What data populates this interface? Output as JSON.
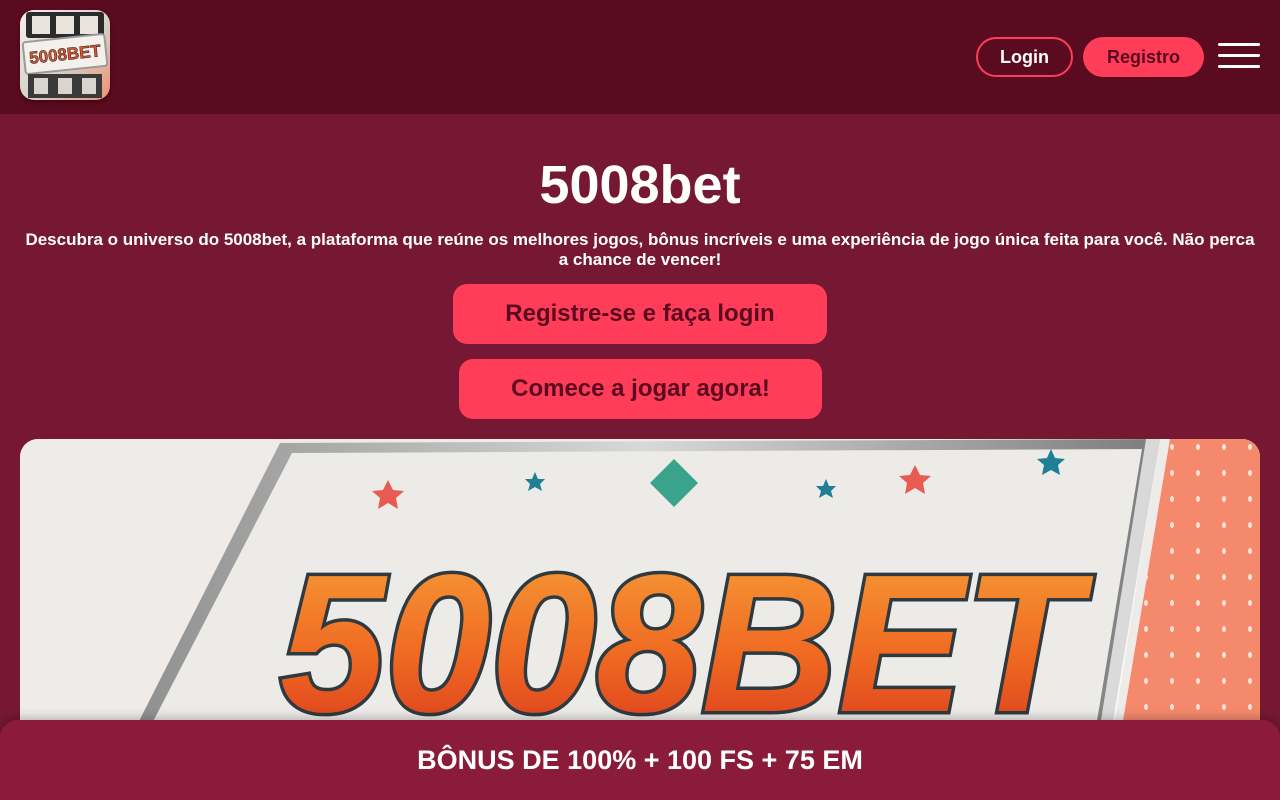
{
  "header": {
    "logo_text": "5008BET",
    "login_label": "Login",
    "register_label": "Registro",
    "menu_icon": "hamburger-menu-icon"
  },
  "hero": {
    "title": "5008bet",
    "description": "Descubra o universo do 5008bet, a plataforma que reúne os melhores jogos, bônus incríveis e uma experiência de jogo única feita para você. Não perca a chance de vencer!",
    "cta_primary": "Registre-se e faça login",
    "cta_secondary": "Comece a jogar agora!"
  },
  "banner": {
    "text": "5008BET"
  },
  "bonus_bar": {
    "text": "BÔNUS DE 100% + 100 FS + 75 EM"
  },
  "colors": {
    "page_background": "#761833",
    "header_background": "#5a0b1f",
    "accent": "#ff3d59",
    "bonus_bar_background": "#8a1c3a"
  }
}
